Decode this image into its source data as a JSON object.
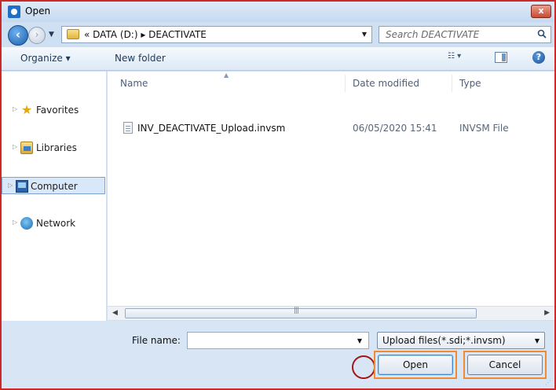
{
  "window": {
    "title": "Open",
    "close_label": "x",
    "colors": {
      "frame": "#cc2a2a",
      "highlight": "#f28a30",
      "click_marker": "#a31414"
    }
  },
  "navigation": {
    "back_icon": "back-arrow-icon",
    "forward_icon": "forward-arrow-icon",
    "address_path": "« DATA (D:) ▸ DEACTIVATE",
    "search_placeholder": "Search DEACTIVATE"
  },
  "toolbar": {
    "organize_label": "Organize ▾",
    "new_folder_label": "New folder"
  },
  "sidebar": {
    "items": [
      {
        "label": "Favorites",
        "icon": "star-icon"
      },
      {
        "label": "Libraries",
        "icon": "libraries-icon"
      },
      {
        "label": "Computer",
        "icon": "computer-icon",
        "selected": true
      },
      {
        "label": "Network",
        "icon": "network-icon"
      }
    ]
  },
  "files": {
    "columns": [
      "Name",
      "Date modified",
      "Type"
    ],
    "rows": [
      {
        "name": "INV_DEACTIVATE_Upload.invsm",
        "date": "06/05/2020 15:41",
        "type": "INVSM File"
      }
    ]
  },
  "footer": {
    "file_name_label": "File name:",
    "file_name_value": "",
    "filter_value": "Upload files(*.sdi;*.invsm)",
    "open_label": "Open",
    "cancel_label": "Cancel"
  }
}
